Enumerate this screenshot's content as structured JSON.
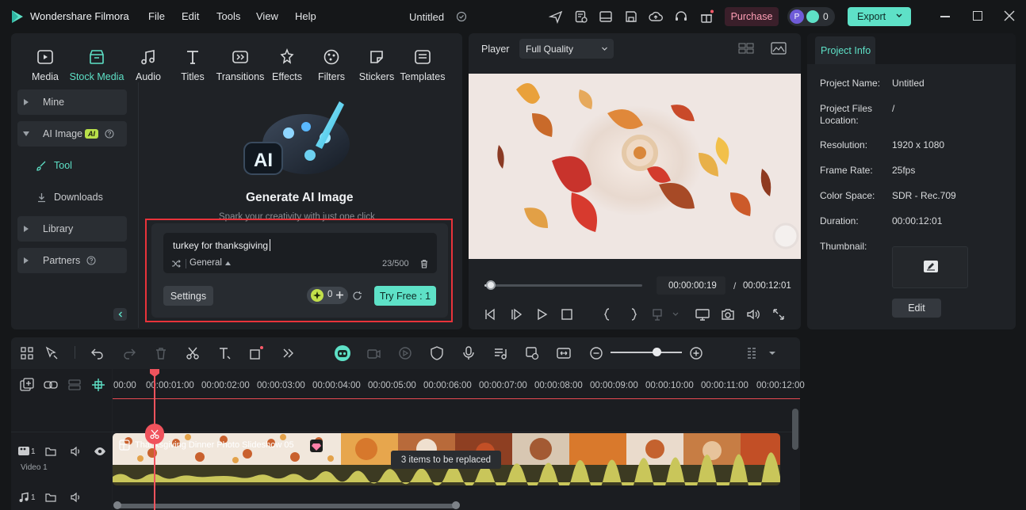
{
  "app": {
    "name": "Wondershare Filmora",
    "project_title": "Untitled",
    "menu": [
      "File",
      "Edit",
      "Tools",
      "View",
      "Help"
    ],
    "purchase_label": "Purchase",
    "avatar_letter": "P",
    "credits": "0",
    "export_label": "Export"
  },
  "media_tabs": [
    {
      "label": "Media",
      "icon": "media-icon"
    },
    {
      "label": "Stock Media",
      "icon": "stock-media-icon",
      "active": true
    },
    {
      "label": "Audio",
      "icon": "audio-icon"
    },
    {
      "label": "Titles",
      "icon": "titles-icon"
    },
    {
      "label": "Transitions",
      "icon": "transitions-icon"
    },
    {
      "label": "Effects",
      "icon": "effects-icon"
    },
    {
      "label": "Filters",
      "icon": "filters-icon"
    },
    {
      "label": "Stickers",
      "icon": "stickers-icon"
    },
    {
      "label": "Templates",
      "icon": "templates-icon"
    }
  ],
  "sidebar": {
    "mine": "Mine",
    "ai_image": "AI Image",
    "ai_badge": "AI",
    "tool": "Tool",
    "downloads": "Downloads",
    "library": "Library",
    "partners": "Partners"
  },
  "generator": {
    "title": "Generate AI Image",
    "subtitle": "Spark your creativity with just one click",
    "prompt": "turkey for thanksgiving",
    "style": "General",
    "char_count": "23/500",
    "settings_label": "Settings",
    "credit_count": "0",
    "try_label": "Try Free : 1"
  },
  "player": {
    "label": "Player",
    "quality": "Full Quality",
    "current_time": "00:00:00:19",
    "separator": "/",
    "total_time": "00:00:12:01",
    "progress_fraction": 0.04
  },
  "project_info": {
    "tab": "Project Info",
    "rows": [
      {
        "label": "Project Name:",
        "value": "Untitled"
      },
      {
        "label": "Project Files Location:",
        "value": "/"
      },
      {
        "label": "Resolution:",
        "value": "1920 x 1080"
      },
      {
        "label": "Frame Rate:",
        "value": "25fps"
      },
      {
        "label": "Color Space:",
        "value": "SDR - Rec.709"
      },
      {
        "label": "Duration:",
        "value": "00:00:12:01"
      }
    ],
    "thumbnail_label": "Thumbnail:",
    "edit_label": "Edit"
  },
  "timeline": {
    "ticks": [
      "00:00",
      "00:00:01:00",
      "00:00:02:00",
      "00:00:03:00",
      "00:00:04:00",
      "00:00:05:00",
      "00:00:06:00",
      "00:00:07:00",
      "00:00:08:00",
      "00:00:09:00",
      "00:00:10:00",
      "00:00:11:00",
      "00:00:12:00"
    ],
    "clip_title": "Thanksgiving Dinner Photo Slideshow 05",
    "replace_tooltip": "3 items to be replaced",
    "video_track_label": "Video 1",
    "video_track_number": "1",
    "audio_track_number": "1"
  },
  "colors": {
    "accent": "#5ee1c7",
    "purchase_bg": "#3a1f2a",
    "purchase_text": "#ff9fb6",
    "highlight_red": "#e8333a",
    "playhead": "#f0535d",
    "audio_wave": "#c9c65a"
  }
}
